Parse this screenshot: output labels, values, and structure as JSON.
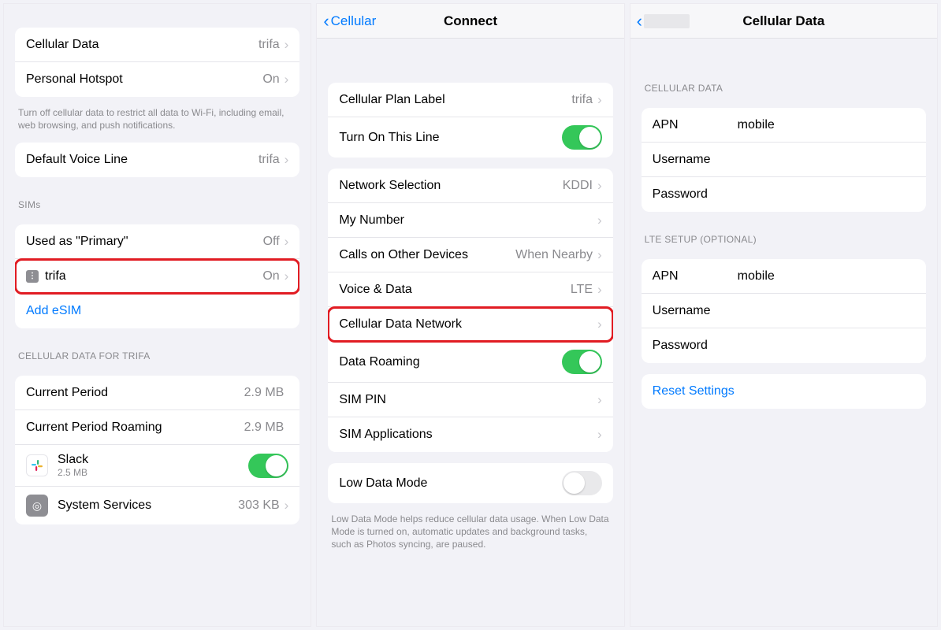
{
  "phone1": {
    "group1": {
      "cellular_data": {
        "label": "Cellular Data",
        "value": "trifa"
      },
      "personal_hotspot": {
        "label": "Personal Hotspot",
        "value": "On"
      }
    },
    "footer1": "Turn off cellular data to restrict all data to Wi-Fi, including email, web browsing, and push notifications.",
    "group2": {
      "default_voice_line": {
        "label": "Default Voice Line",
        "value": "trifa"
      }
    },
    "sims_header": "SIMs",
    "group3": {
      "used_primary": {
        "label": "Used as \"Primary\"",
        "value": "Off"
      },
      "trifa": {
        "label": "trifa",
        "value": "On"
      },
      "add_esim": "Add eSIM"
    },
    "usage_header": "CELLULAR DATA FOR TRIFA",
    "usage": {
      "current_period": {
        "label": "Current Period",
        "value": "2.9 MB"
      },
      "current_period_roaming": {
        "label": "Current Period Roaming",
        "value": "2.9 MB"
      },
      "slack": {
        "label": "Slack",
        "sub": "2.5 MB"
      },
      "system_services": {
        "label": "System Services",
        "value": "303 KB"
      }
    }
  },
  "phone2": {
    "nav": {
      "back": "Cellular",
      "title": "Connect"
    },
    "group1": {
      "plan_label": {
        "label": "Cellular Plan Label",
        "value": "trifa"
      },
      "turn_on": {
        "label": "Turn On This Line"
      }
    },
    "group2": {
      "network_selection": {
        "label": "Network Selection",
        "value": "KDDI"
      },
      "my_number": {
        "label": "My Number"
      },
      "calls_other": {
        "label": "Calls on Other Devices",
        "value": "When Nearby"
      },
      "voice_data": {
        "label": "Voice & Data",
        "value": "LTE"
      },
      "cdn": {
        "label": "Cellular Data Network"
      },
      "data_roaming": {
        "label": "Data Roaming"
      },
      "sim_pin": {
        "label": "SIM PIN"
      },
      "sim_apps": {
        "label": "SIM Applications"
      }
    },
    "group3": {
      "low_data": {
        "label": "Low Data Mode"
      }
    },
    "footer3": "Low Data Mode helps reduce cellular data usage. When Low Data Mode is turned on, automatic updates and background tasks, such as Photos syncing, are paused."
  },
  "phone3": {
    "nav": {
      "title": "Cellular Data"
    },
    "header1": "CELLULAR DATA",
    "group1": {
      "apn": {
        "label": "APN",
        "value": "mobile"
      },
      "username": {
        "label": "Username",
        "value": ""
      },
      "password": {
        "label": "Password",
        "value": ""
      }
    },
    "header2": "LTE SETUP (OPTIONAL)",
    "group2": {
      "apn": {
        "label": "APN",
        "value": "mobile"
      },
      "username": {
        "label": "Username",
        "value": ""
      },
      "password": {
        "label": "Password",
        "value": ""
      }
    },
    "reset": "Reset Settings"
  }
}
